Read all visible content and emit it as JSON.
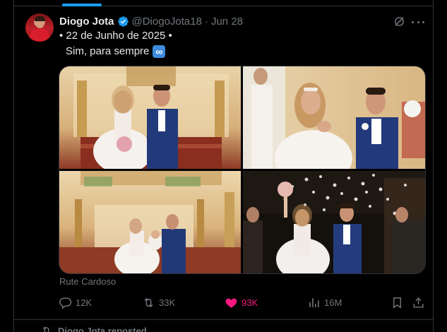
{
  "post": {
    "author_name": "Diogo Jota",
    "author_handle": "@DiogoJota18",
    "separator": "·",
    "date": "Jun 28",
    "text_line1": "• 22 de Junho de 2025 •",
    "text_line2": "Sim, para sempre",
    "emoji_text": "∞",
    "emoji_name": "infinity-emoji",
    "photo_credit": "Rute Cardoso"
  },
  "media": {
    "photos": [
      {
        "name": "wedding-photo-altar"
      },
      {
        "name": "wedding-photo-ring"
      },
      {
        "name": "wedding-photo-church-wide"
      },
      {
        "name": "wedding-photo-confetti"
      }
    ]
  },
  "actions": {
    "replies": "12K",
    "reposts": "33K",
    "likes": "93K",
    "views": "16M"
  },
  "next_item": {
    "label": "Diogo Jota reposted"
  },
  "icons": {
    "verified": "verified-badge-icon",
    "grok": "grok-icon",
    "more": "more-icon",
    "reply": "reply-icon",
    "repost": "repost-icon",
    "like": "heart-icon",
    "views": "views-icon",
    "bookmark": "bookmark-icon",
    "share": "share-icon"
  },
  "colors": {
    "background": "#000000",
    "text": "#e7e9ea",
    "muted": "#71767b",
    "accent": "#1d9bf0",
    "like": "#f91880",
    "border": "#2f3336"
  }
}
